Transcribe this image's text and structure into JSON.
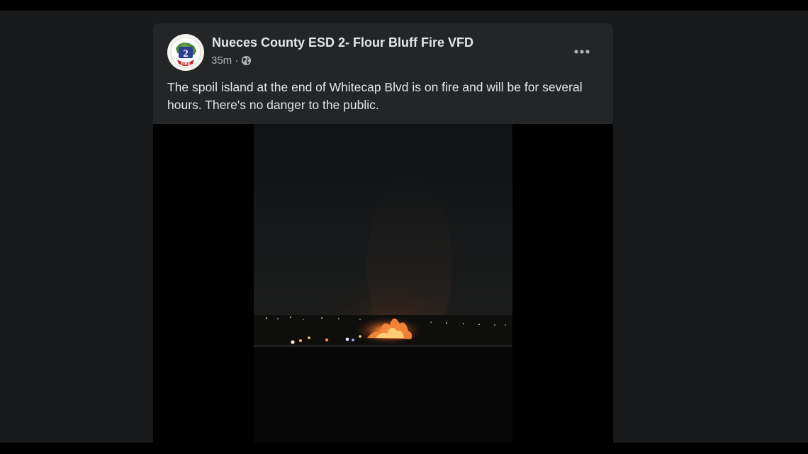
{
  "post": {
    "page_name": "Nueces County ESD 2- Flour Bluff Fire VFD",
    "time_ago": "35m",
    "separator": "·",
    "audience_icon": "globe-icon",
    "more_icon": "more-options-icon",
    "text": "The spoil island at the end of Whitecap Blvd is on fire and will be for several hours. There's no danger to the public.",
    "avatar": {
      "icon": "fire-department-logo",
      "badge_number": "2",
      "badge_text": "FIRE"
    }
  },
  "colors": {
    "background": "#18191a",
    "card": "#242526",
    "primary_text": "#e4e6eb",
    "secondary_text": "#b0b3b8",
    "fire_glow": "#e8612a"
  }
}
